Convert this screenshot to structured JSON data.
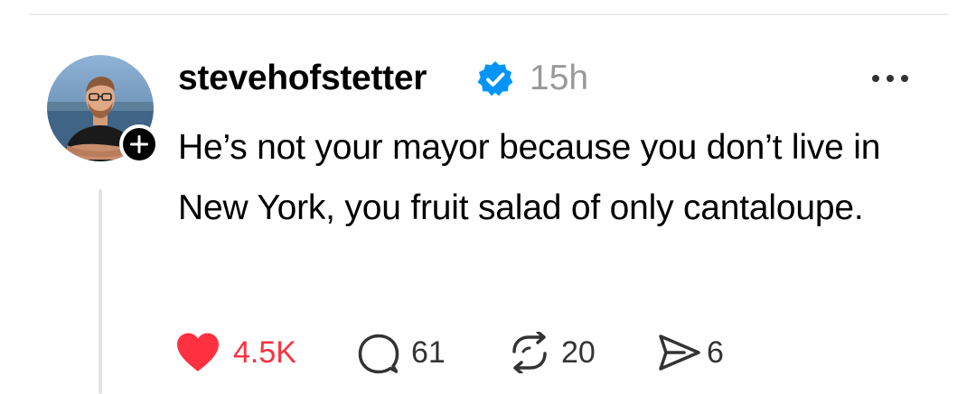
{
  "post": {
    "author": {
      "username": "stevehofstetter",
      "verified": true,
      "avatar_icon": "avatar-photo"
    },
    "timestamp": "15h",
    "text": "He’s not your mayor because you don’t live in New York, you fruit salad of only cantaloupe.",
    "actions": {
      "like": {
        "icon": "heart-filled-icon",
        "count": "4.5K",
        "color": "#ff3040"
      },
      "reply": {
        "icon": "comment-bubble-icon",
        "count": "61"
      },
      "repost": {
        "icon": "repost-icon",
        "count": "20"
      },
      "share": {
        "icon": "send-icon",
        "count": "6"
      }
    },
    "more_icon": "more-horizontal-icon"
  },
  "colors": {
    "verified_blue": "#0095f6",
    "like_red": "#ff3040",
    "muted_text": "#999999",
    "thread_line": "#e3e3e3"
  }
}
